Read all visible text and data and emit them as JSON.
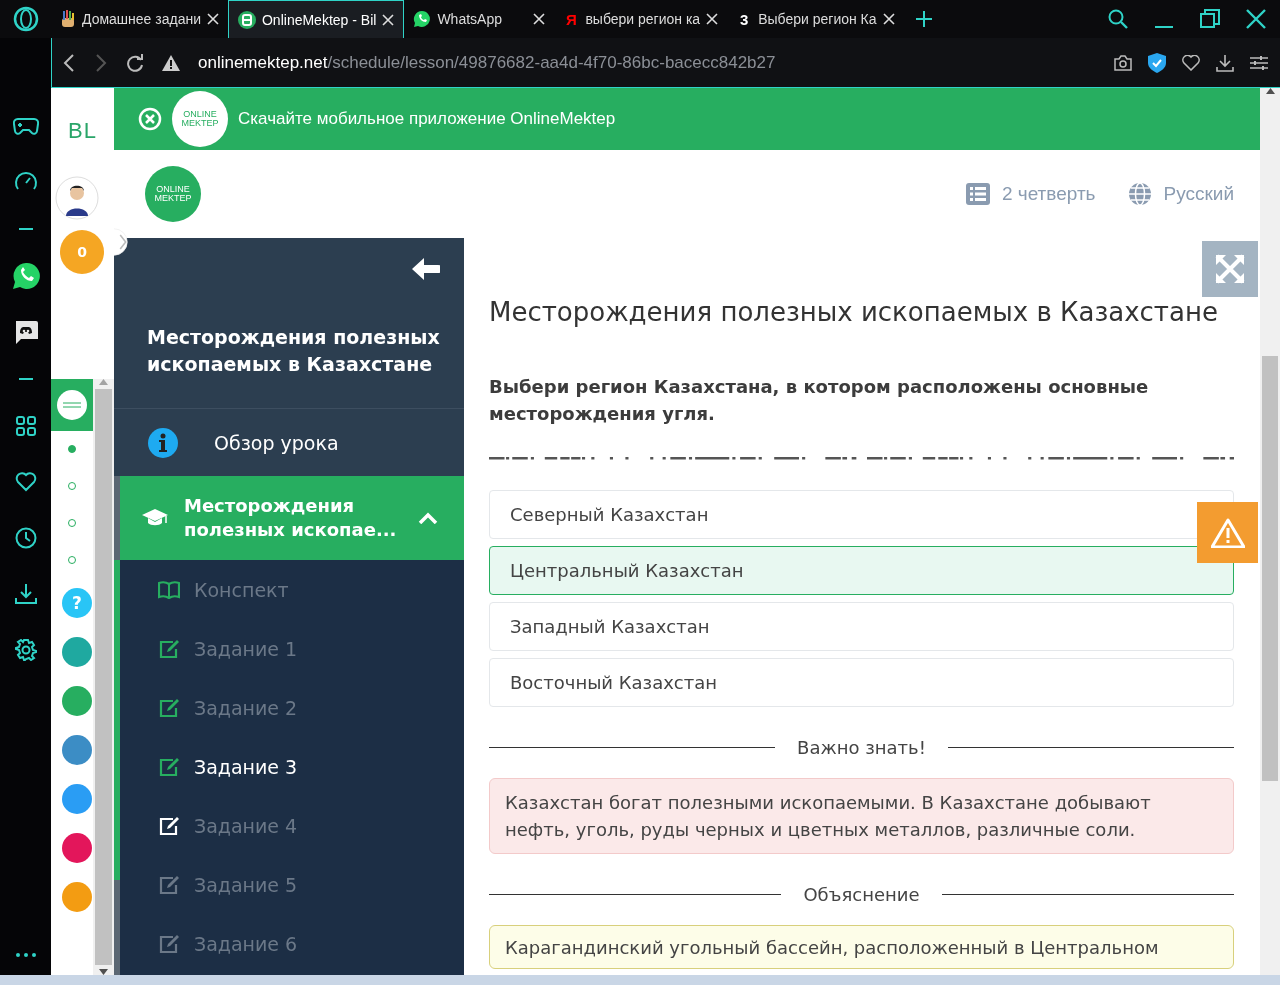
{
  "browser": {
    "tabs": [
      {
        "kind": "hand",
        "title": "Домашнее задани",
        "selected": false
      },
      {
        "kind": "app",
        "title": "OnlineMektep - Bil",
        "selected": true
      },
      {
        "kind": "whatsapp",
        "title": "WhatsApp",
        "selected": false
      },
      {
        "kind": "letter",
        "badge": "Я",
        "title": "выбери регион ка",
        "selected": false
      },
      {
        "kind": "letter",
        "badge": "3",
        "title": "Выбери регион Ка",
        "selected": false
      }
    ],
    "address": {
      "host": "onlinemektep.net",
      "path": "/schedule/lesson/49876682-aa4d-4f70-86bc-bacecc842b27"
    }
  },
  "bl_panel": {
    "logo": "BL",
    "score": "0",
    "steps": [
      {
        "selected": true
      },
      {
        "selected": false
      },
      {
        "selected": false
      },
      {
        "selected": false
      }
    ],
    "apps": [
      {
        "color": "#29c5f6",
        "label": "?"
      },
      {
        "color": "#1fa9a0"
      },
      {
        "color": "#27ae60"
      },
      {
        "color": "#3c8dc5"
      },
      {
        "color": "#2a9df4"
      },
      {
        "color": "#e3165b"
      },
      {
        "color": "#f39c12"
      }
    ]
  },
  "page": {
    "banner": {
      "logo": [
        "ONLINE",
        "MEKTEP"
      ],
      "text": "Скачайте мобильное приложение OnlineMektep"
    },
    "header": {
      "logo": [
        "ONLINE",
        "MEKTEP"
      ],
      "quarter": "2 четверть",
      "language": "Русский"
    },
    "sidebar": {
      "title": "Месторождения полезных ископаемых в Казахстане",
      "overview": "Обзор урока",
      "section": {
        "title": "Месторождения полезных ископае...",
        "expanded": true
      },
      "items": [
        {
          "kind": "notes",
          "label": "Конспект",
          "color": "#27ae60",
          "selected": false
        },
        {
          "kind": "task",
          "label": "Задание 1",
          "color": "#27ae60",
          "selected": false
        },
        {
          "kind": "task",
          "label": "Задание 2",
          "color": "#27ae60",
          "selected": false
        },
        {
          "kind": "task",
          "label": "Задание 3",
          "color": "#27ae60",
          "selected": true
        },
        {
          "kind": "task",
          "label": "Задание 4",
          "color": "#ffffff",
          "selected": false
        },
        {
          "kind": "task",
          "label": "Задание 5",
          "color": "#6b7888",
          "selected": false
        },
        {
          "kind": "task",
          "label": "Задание 6",
          "color": "#6b7888",
          "selected": false
        }
      ]
    },
    "content": {
      "title": "Месторождения полезных ископаемых в Казахстане",
      "question": "Выбери регион Казахстана, в котором расположены основные месторождения угля.",
      "options": [
        {
          "label": "Северный Казахстан",
          "selected": false
        },
        {
          "label": "Центральный Казахстан",
          "selected": true
        },
        {
          "label": "Западный Казахстан",
          "selected": false
        },
        {
          "label": "Восточный Казахстан",
          "selected": false
        }
      ],
      "sections": [
        {
          "kind": "important",
          "heading": "Важно знать!",
          "text": "Казахстан богат полезными ископаемыми. В Казахстане добывают нефть, уголь, руды черных и цветных металлов, различные соли."
        },
        {
          "kind": "explanation",
          "heading": "Объяснение",
          "text": "Карагандинский угольный бассейн, расположенный в Центральном"
        }
      ]
    }
  }
}
